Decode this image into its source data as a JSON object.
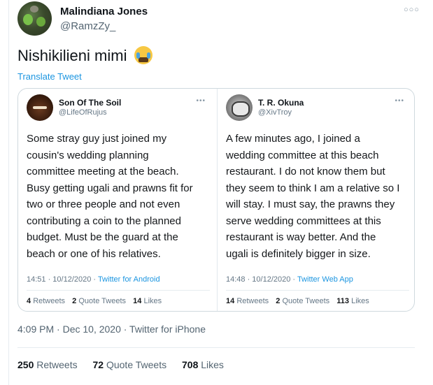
{
  "tweet": {
    "author_name": "Malindiana Jones",
    "author_handle": "@RamzZy_",
    "more_icon": "more-horizontal-icon",
    "text": "Nishikilieni mimi",
    "emoji": "loudly-crying-face",
    "translate_label": "Translate Tweet",
    "timestamp": "4:09 PM · Dec 10, 2020 · Twitter for iPhone",
    "stats": {
      "retweets_count": "250",
      "retweets_label": "Retweets",
      "quotes_count": "72",
      "quotes_label": "Quote Tweets",
      "likes_count": "708",
      "likes_label": "Likes"
    }
  },
  "quote_left": {
    "name": "Son Of The Soil",
    "handle": "@LifeOfRujus",
    "body_lines": [
      "Some stray guy just joined my",
      "cousin's wedding planning",
      "committee meeting at the beach.",
      "Busy getting ugali and prawns fit for",
      "two or three people and not even",
      "contributing a coin to the planned",
      "budget. Must be the guard at the",
      "beach or one of his relatives."
    ],
    "time": "14:51 · 10/12/2020 · ",
    "source": "Twitter for Android",
    "retweets_count": "4",
    "retweets_label": "Retweets",
    "quotes_count": "2",
    "quotes_label": "Quote Tweets",
    "likes_count": "14",
    "likes_label": "Likes"
  },
  "quote_right": {
    "name": "T. R. Okuna",
    "handle": "@XivTroy",
    "body_lines": [
      "A few minutes ago, I joined a",
      "wedding committee at this beach",
      "restaurant. I do not know them but",
      "they seem to think I am a relative so I",
      "will stay. I must say, the prawns they",
      "serve wedding committees at this",
      "restaurant is way better. And the",
      "ugali is definitely bigger in size."
    ],
    "time": "14:48 · 10/12/2020 · ",
    "source": "Twitter Web App",
    "retweets_count": "14",
    "retweets_label": "Retweets",
    "quotes_count": "2",
    "quotes_label": "Quote Tweets",
    "likes_count": "113",
    "likes_label": "Likes"
  }
}
